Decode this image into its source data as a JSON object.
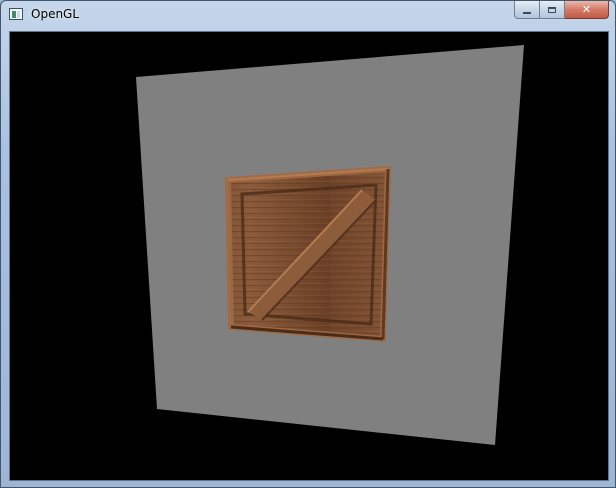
{
  "window": {
    "title": "OpenGL",
    "icon": "opengl-app-icon",
    "controls": {
      "minimize_icon": "minimize-icon",
      "maximize_icon": "maximize-icon",
      "close_icon": "close-icon",
      "close_glyph": "✕"
    }
  },
  "scene": {
    "background_color": "#000000",
    "plane_color": "#808080",
    "crate_wood_color": "#7a4e32",
    "crate_highlight_color": "#a06a44",
    "crate_shadow_color": "#4a2c18"
  }
}
